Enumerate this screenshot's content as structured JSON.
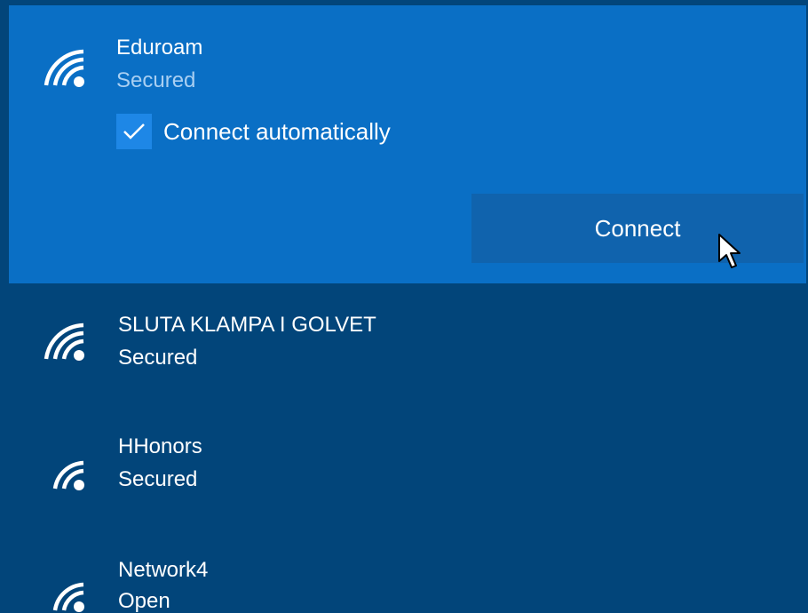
{
  "networks": [
    {
      "name": "Eduroam",
      "status": "Secured",
      "selected": true,
      "icon": "wifi-icon"
    },
    {
      "name": "SLUTA KLAMPA I GOLVET",
      "status": "Secured",
      "selected": false,
      "icon": "wifi-icon"
    },
    {
      "name": "HHonors",
      "status": "Secured",
      "selected": false,
      "icon": "wifi-icon"
    },
    {
      "name": "Network4",
      "status": "Open",
      "selected": false,
      "icon": "wifi-icon"
    }
  ],
  "selected_panel": {
    "connect_automatically_label": "Connect automatically",
    "connect_automatically_checked": true,
    "connect_button_label": "Connect"
  },
  "colors": {
    "background": "#02457a",
    "selected_background": "#0a6fc5",
    "checkbox_fill": "#1e87e6",
    "button_fill": "#1063ad",
    "secondary_text": "#a9cff2"
  }
}
